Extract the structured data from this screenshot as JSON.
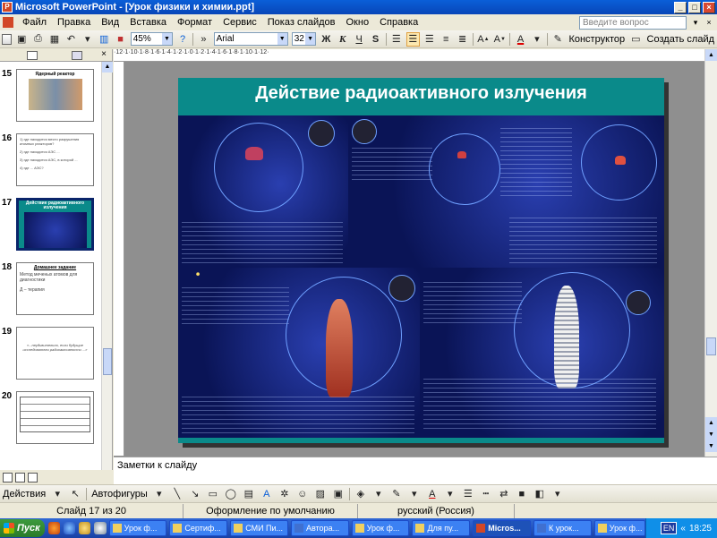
{
  "window": {
    "title": "Microsoft PowerPoint - [Урок физики и химии.ppt]",
    "controls": [
      "_",
      "□",
      "×"
    ]
  },
  "menu": {
    "items": [
      "Файл",
      "Правка",
      "Вид",
      "Вставка",
      "Формат",
      "Сервис",
      "Показ слайдов",
      "Окно",
      "Справка"
    ],
    "help_placeholder": "Введите вопрос"
  },
  "toolbar": {
    "zoom": "45%",
    "font": "Arial",
    "size": "32",
    "bold": "Ж",
    "italic": "К",
    "underline": "Ч",
    "shadow": "S",
    "designer": "Конструктор",
    "new_slide": "Создать слайд"
  },
  "slides": [
    {
      "num": "15",
      "title": "Ядерный реактор",
      "lines": []
    },
    {
      "num": "16",
      "title": "",
      "lines": [
        "1) где находится место разрушения атомных реакторов?",
        "2) где находится АЭС ...",
        "3) где находится АЭС, в которой ...",
        "4) где ... АЭС?"
      ]
    },
    {
      "num": "17",
      "title": "Действие радиоактивного излучения",
      "lines": []
    },
    {
      "num": "18",
      "title": "Домашнее задание",
      "lines": [
        "Метод меченых атомов для диагностики",
        "Д – терапия"
      ]
    },
    {
      "num": "19",
      "title": "",
      "lines": [
        "«...неудивительно, если будущие исследователи радиоактивности ...»"
      ]
    },
    {
      "num": "20",
      "title": "",
      "lines": []
    }
  ],
  "current_slide": {
    "title": "Действие радиоактивного излучения"
  },
  "notes": {
    "placeholder": "Заметки к слайду"
  },
  "draw_toolbar": {
    "actions": "Действия",
    "autoshapes": "Автофигуры"
  },
  "status": {
    "slide": "Слайд 17 из 20",
    "design": "Оформление по умолчанию",
    "language": "русский (Россия)"
  },
  "taskbar": {
    "start": "Пуск",
    "tasks": [
      "Урок ф...",
      "Сертиф...",
      "СМИ Пи...",
      "Автора...",
      "Урок ф...",
      "Для пу...",
      "Micros...",
      "К урок...",
      "Урок ф..."
    ],
    "active_index": 6,
    "lang": "EN",
    "time": "18:25"
  },
  "colors": {
    "titlebar": "#0846b8",
    "slide_bg": "#0a8a8a",
    "panel": "#0a1456"
  }
}
